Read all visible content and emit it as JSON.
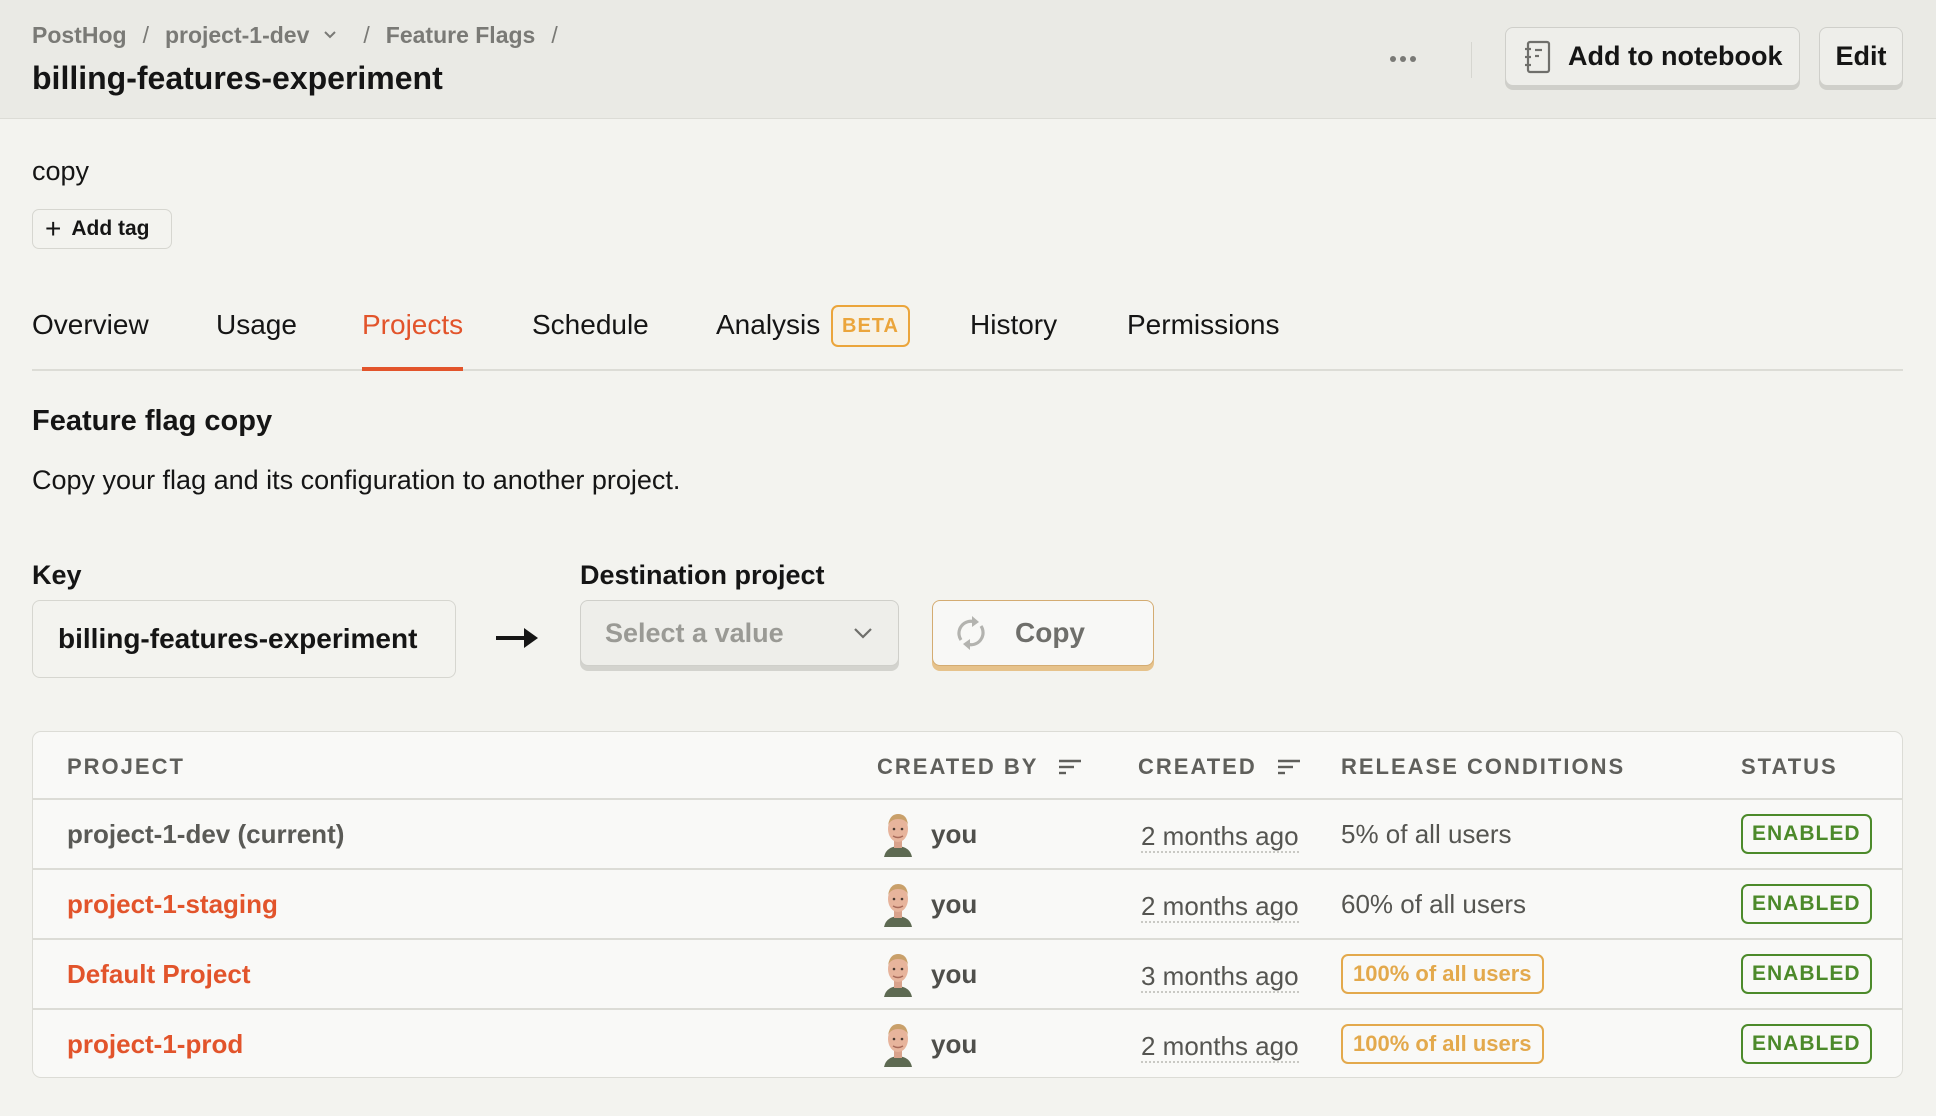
{
  "header": {
    "breadcrumb": [
      "PostHog",
      "project-1-dev",
      "Feature Flags"
    ],
    "title": "billing-features-experiment",
    "more_label": "More options",
    "add_to_notebook": "Add to notebook",
    "edit": "Edit"
  },
  "flag": {
    "description": "copy",
    "add_tag": "Add tag"
  },
  "tabs": [
    {
      "label": "Overview",
      "active": false
    },
    {
      "label": "Usage",
      "active": false
    },
    {
      "label": "Projects",
      "active": true
    },
    {
      "label": "Schedule",
      "active": false
    },
    {
      "label": "Analysis",
      "active": false,
      "badge": "BETA"
    },
    {
      "label": "History",
      "active": false
    },
    {
      "label": "Permissions",
      "active": false
    }
  ],
  "copy_section": {
    "title": "Feature flag copy",
    "description": "Copy your flag and its configuration to another project.",
    "key_label": "Key",
    "key_value": "billing-features-experiment",
    "destination_label": "Destination project",
    "destination_placeholder": "Select a value",
    "copy_button": "Copy"
  },
  "table": {
    "columns": [
      "PROJECT",
      "CREATED BY",
      "CREATED",
      "RELEASE CONDITIONS",
      "STATUS"
    ],
    "rows": [
      {
        "project": "project-1-dev (current)",
        "current": true,
        "created_by": "you",
        "created": "2 months ago",
        "release": "5% of all users",
        "release_full": false,
        "status": "ENABLED"
      },
      {
        "project": "project-1-staging",
        "current": false,
        "created_by": "you",
        "created": "2 months ago",
        "release": "60% of all users",
        "release_full": false,
        "status": "ENABLED"
      },
      {
        "project": "Default Project",
        "current": false,
        "created_by": "you",
        "created": "3 months ago",
        "release": "100% of all users",
        "release_full": true,
        "status": "ENABLED"
      },
      {
        "project": "project-1-prod",
        "current": false,
        "created_by": "you",
        "created": "2 months ago",
        "release": "100% of all users",
        "release_full": true,
        "status": "ENABLED"
      }
    ]
  },
  "colors": {
    "accent": "#e2542b",
    "beta": "#eba53b",
    "enabled": "#4c8a2a",
    "full_rollout": "#e3a94c"
  }
}
